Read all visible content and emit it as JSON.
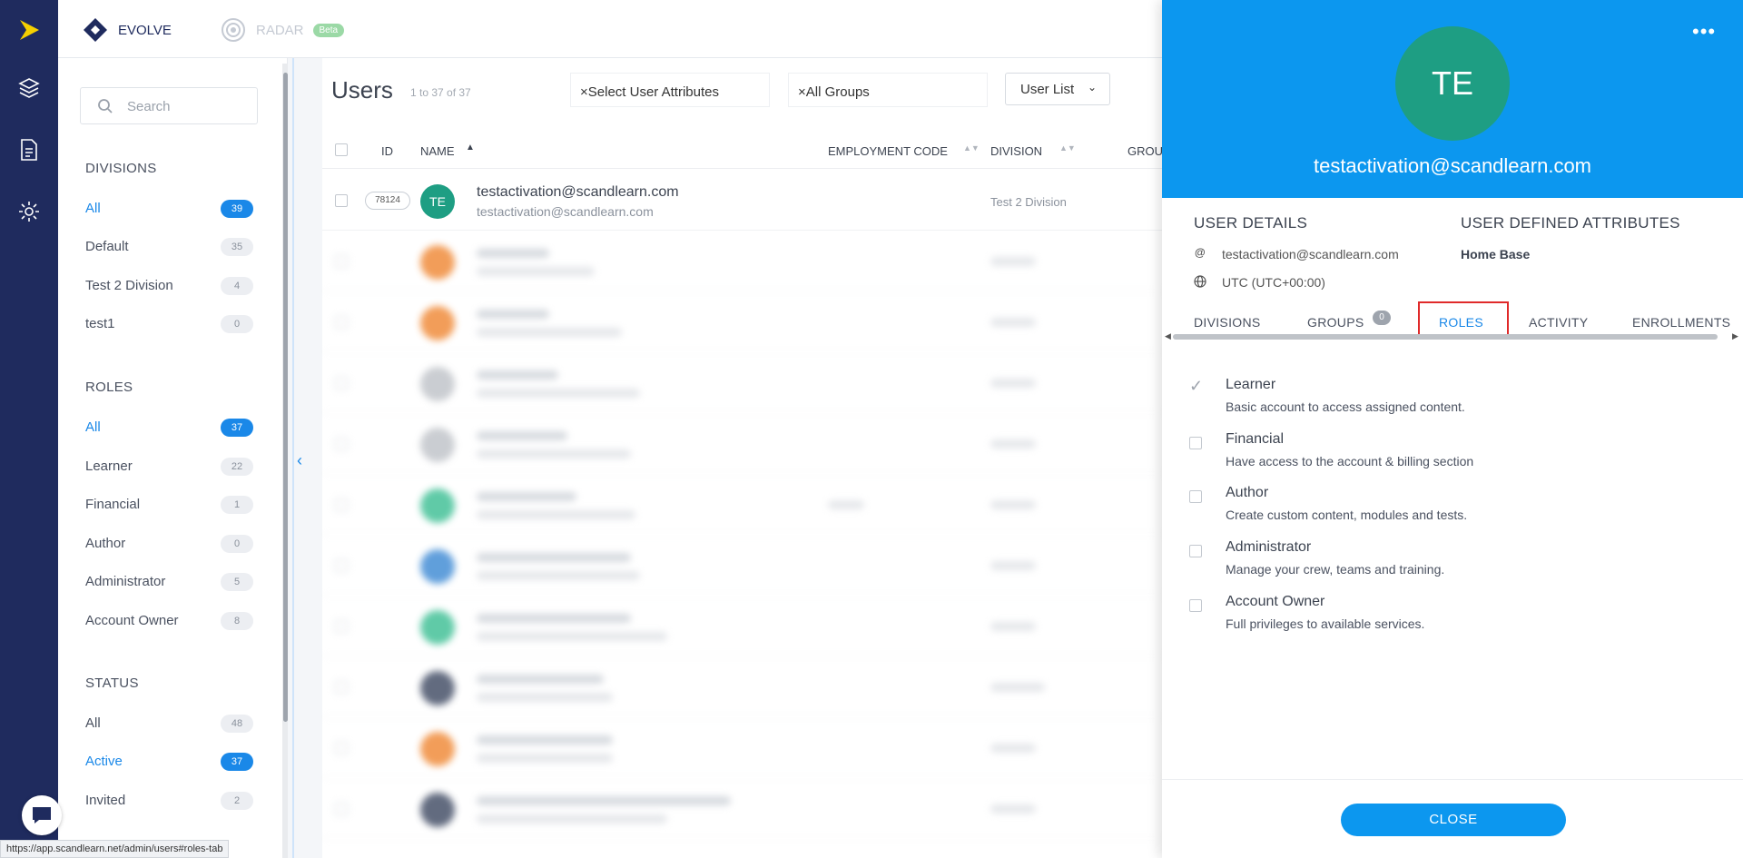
{
  "brand": {
    "primary": "EVOLVE",
    "secondary": "RADAR",
    "badge": "Beta"
  },
  "sidebar": {
    "search_placeholder": "Search",
    "divisions": {
      "title": "DIVISIONS",
      "items": [
        {
          "label": "All",
          "count": "39",
          "active": true
        },
        {
          "label": "Default",
          "count": "35"
        },
        {
          "label": "Test 2 Division",
          "count": "4"
        },
        {
          "label": "test1",
          "count": "0"
        }
      ]
    },
    "roles": {
      "title": "ROLES",
      "items": [
        {
          "label": "All",
          "count": "37",
          "active": true
        },
        {
          "label": "Learner",
          "count": "22"
        },
        {
          "label": "Financial",
          "count": "1"
        },
        {
          "label": "Author",
          "count": "0"
        },
        {
          "label": "Administrator",
          "count": "5"
        },
        {
          "label": "Account Owner",
          "count": "8"
        }
      ]
    },
    "status": {
      "title": "STATUS",
      "items": [
        {
          "label": "All",
          "count": "48"
        },
        {
          "label": "Active",
          "count": "37",
          "active": true
        },
        {
          "label": "Invited",
          "count": "2"
        }
      ]
    }
  },
  "main": {
    "title": "Users",
    "count": "1 to 37 of 37",
    "filter_attributes": "×Select User Attributes",
    "filter_groups": "×All Groups",
    "view_button": "User List",
    "columns": {
      "id": "ID",
      "name": "NAME",
      "employment_code": "EMPLOYMENT CODE",
      "division": "DIVISION",
      "groups": "GROU"
    },
    "first_row": {
      "id": "78124",
      "initials": "TE",
      "name": "testactivation@scandlearn.com",
      "email": "testactivation@scandlearn.com",
      "division": "Test 2 Division"
    }
  },
  "panel": {
    "initials": "TE",
    "email": "testactivation@scandlearn.com",
    "user_details_title": "USER DETAILS",
    "user_defined_title": "USER DEFINED ATTRIBUTES",
    "detail_email": "testactivation@scandlearn.com",
    "detail_timezone": "UTC (UTC+00:00)",
    "attribute_home_base": "Home Base",
    "tabs": {
      "divisions": "DIVISIONS",
      "groups": "GROUPS",
      "groups_count": "0",
      "roles": "ROLES",
      "activity": "ACTIVITY",
      "enrollments": "ENROLLMENTS"
    },
    "roles": [
      {
        "name": "Learner",
        "desc": "Basic account to access assigned content.",
        "checked": true
      },
      {
        "name": "Financial",
        "desc": "Have access to the account & billing section"
      },
      {
        "name": "Author",
        "desc": "Create custom content, modules and tests."
      },
      {
        "name": "Administrator",
        "desc": "Manage your crew, teams and training."
      },
      {
        "name": "Account Owner",
        "desc": "Full privileges to available services."
      }
    ],
    "close_label": "CLOSE"
  },
  "status_url": "https://app.scandlearn.net/admin/users#roles-tab",
  "colors": {
    "rail": "#1f2b5e",
    "accent": "#1a88e8",
    "panel_header": "#0c97ef",
    "avatar_green": "#1e9e83",
    "highlight": "#e02a2a"
  }
}
